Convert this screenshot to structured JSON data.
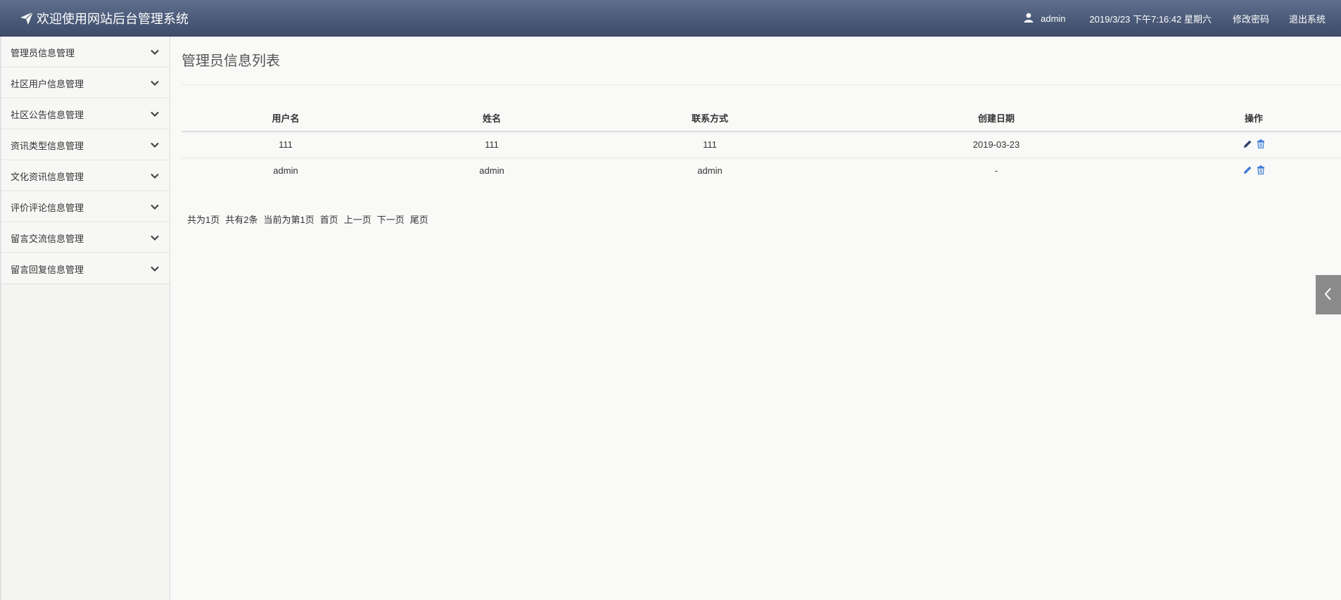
{
  "header": {
    "title": "欢迎使用网站后台管理系统",
    "username": "admin",
    "datetime": "2019/3/23 下午7:16:42 星期六",
    "change_password": "修改密码",
    "logout": "退出系统"
  },
  "sidebar": {
    "items": [
      {
        "label": "管理员信息管理"
      },
      {
        "label": "社区用户信息管理"
      },
      {
        "label": "社区公告信息管理"
      },
      {
        "label": "资讯类型信息管理"
      },
      {
        "label": "文化资讯信息管理"
      },
      {
        "label": "评价评论信息管理"
      },
      {
        "label": "留言交流信息管理"
      },
      {
        "label": "留言回复信息管理"
      }
    ]
  },
  "main": {
    "title": "管理员信息列表",
    "table": {
      "headers": [
        "用户名",
        "姓名",
        "联系方式",
        "创建日期",
        "操作"
      ],
      "rows": [
        {
          "username": "111",
          "name": "111",
          "contact": "111",
          "created": "2019-03-23"
        },
        {
          "username": "admin",
          "name": "admin",
          "contact": "admin",
          "created": "-"
        }
      ]
    },
    "pager": {
      "total_pages": "共为1页",
      "total_records": "共有2条",
      "current": "当前为第1页",
      "first": "首页",
      "prev": "上一页",
      "next": "下一页",
      "last": "尾页"
    }
  },
  "icons": {
    "brand": "paper-plane-icon",
    "user": "user-icon",
    "chevron": "chevron-down-icon",
    "edit": "pencil-icon",
    "delete": "trash-icon",
    "collapse": "chevron-left-icon"
  },
  "colors": {
    "header_bg": "#4a5a78",
    "edit_icon": "#3a7bd5",
    "delete_icon": "#3a7bd5"
  }
}
